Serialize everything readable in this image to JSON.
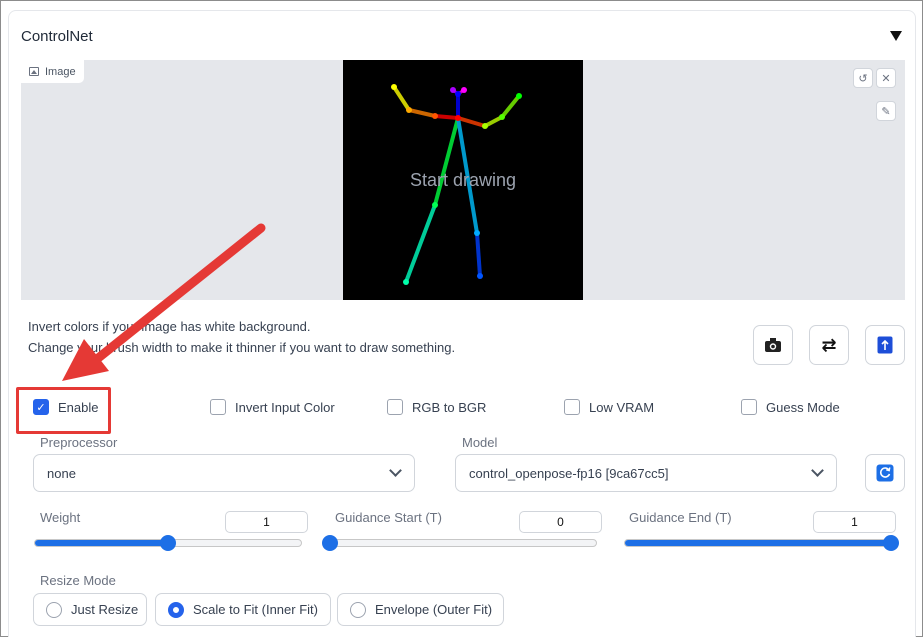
{
  "panel": {
    "title": "ControlNet"
  },
  "image": {
    "label": "Image",
    "placeholder": "Start drawing"
  },
  "hints": {
    "line1": "Invert colors if your image has white background.",
    "line2": "Change your brush width to make it thinner if you want to draw something."
  },
  "checkboxes": {
    "enable": {
      "label": "Enable",
      "checked": true
    },
    "invert": {
      "label": "Invert Input Color",
      "checked": false
    },
    "rgb_bgr": {
      "label": "RGB to BGR",
      "checked": false
    },
    "low_vram": {
      "label": "Low VRAM",
      "checked": false
    },
    "guess_mode": {
      "label": "Guess Mode",
      "checked": false
    }
  },
  "preprocessor": {
    "label": "Preprocessor",
    "value": "none"
  },
  "model": {
    "label": "Model",
    "value": "control_openpose-fp16 [9ca67cc5]"
  },
  "sliders": {
    "weight": {
      "label": "Weight",
      "value": "1",
      "fraction": 0.5
    },
    "guidance_start": {
      "label": "Guidance Start (T)",
      "value": "0",
      "fraction": 0.0
    },
    "guidance_end": {
      "label": "Guidance End (T)",
      "value": "1",
      "fraction": 1.0
    }
  },
  "resize": {
    "label": "Resize Mode",
    "options": [
      "Just Resize",
      "Scale to Fit (Inner Fit)",
      "Envelope (Outer Fit)"
    ],
    "selected": "Scale to Fit (Inner Fit)"
  },
  "colors": {
    "accent": "#2563eb",
    "annotation": "#e53935"
  }
}
